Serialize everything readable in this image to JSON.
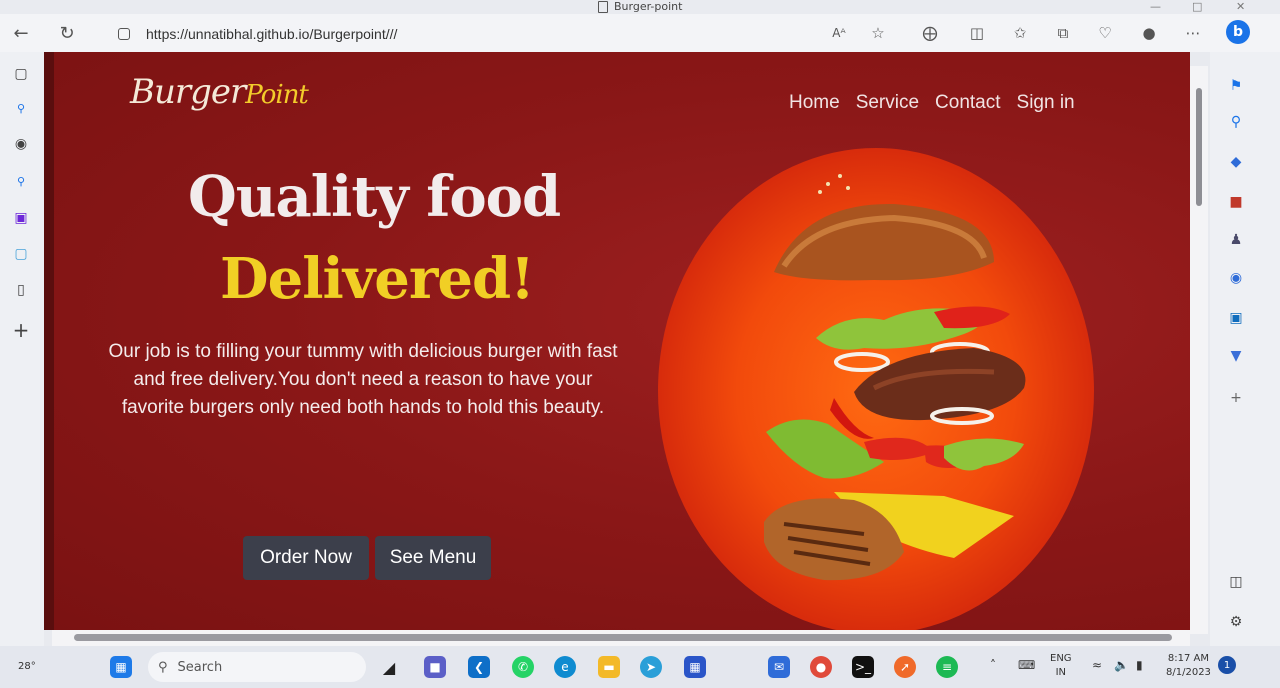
{
  "browser": {
    "tab_title": "Burger-point",
    "url": "https://unnatibhal.github.io/Burgerpoint///",
    "read_aloud_label": "Aᴬ"
  },
  "site": {
    "logo_main": "Burger",
    "logo_accent": "Point",
    "nav": [
      "Home",
      "Service",
      "Contact",
      "Sign in"
    ],
    "heading_line1": "Quality food",
    "heading_line2": "Delivered!",
    "description": "Our job is to filling your tummy with delicious burger with fast and free delivery.You don't need a reason to have your favorite burgers only need both hands to hold this beauty.",
    "order_button": "Order Now",
    "menu_button": "See Menu",
    "colors": {
      "background": "#8a1717",
      "accent_yellow": "#f1cf25",
      "button": "#3c3f4b"
    }
  },
  "taskbar": {
    "weather": "28°",
    "search_placeholder": "Search",
    "language": "ENG",
    "region": "IN",
    "time": "8:17 AM",
    "date": "8/1/2023",
    "notification_count": "1"
  }
}
